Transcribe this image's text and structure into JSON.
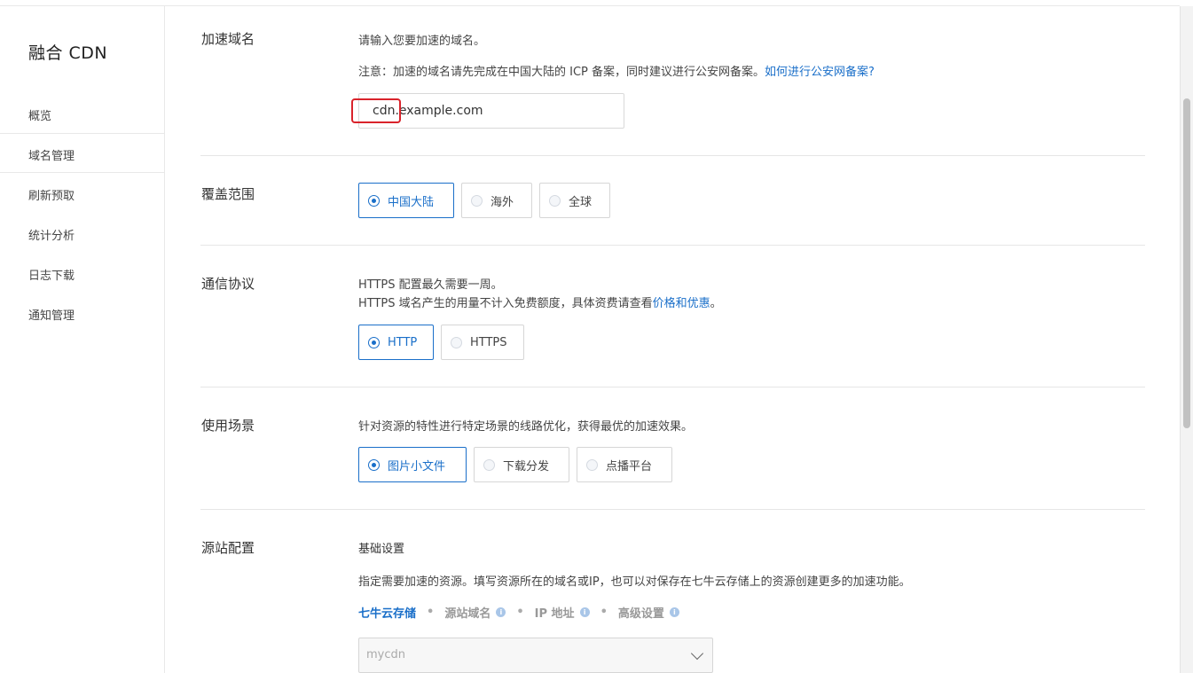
{
  "sidebar": {
    "brand": "融合 CDN",
    "items": [
      {
        "label": "概览"
      },
      {
        "label": "域名管理"
      },
      {
        "label": "刷新预取"
      },
      {
        "label": "统计分析"
      },
      {
        "label": "日志下载"
      },
      {
        "label": "通知管理"
      }
    ],
    "active_index": 1
  },
  "domain": {
    "title": "加速域名",
    "hint": "请输入您要加速的域名。",
    "note": "注意：加速的域名请先完成在中国大陆的 ICP 备案，同时建议进行公安网备案。",
    "note_link": "如何进行公安网备案?",
    "value": "cdn.example.com"
  },
  "coverage": {
    "title": "覆盖范围",
    "options": [
      "中国大陆",
      "海外",
      "全球"
    ],
    "selected": "中国大陆"
  },
  "protocol": {
    "title": "通信协议",
    "line1": "HTTPS 配置最久需要一周。",
    "line2": "HTTPS 域名产生的用量不计入免费额度，具体资费请查看",
    "line2_link": "价格和优惠",
    "line2_end": "。",
    "options": [
      "HTTP",
      "HTTPS"
    ],
    "selected": "HTTP"
  },
  "scenario": {
    "title": "使用场景",
    "desc": "针对资源的特性进行特定场景的线路优化，获得最优的加速效果。",
    "options": [
      "图片小文件",
      "下载分发",
      "点播平台"
    ],
    "selected": "图片小文件"
  },
  "origin": {
    "title": "源站配置",
    "subtitle": "基础设置",
    "desc": "指定需要加速的资源。填写资源所在的域名或IP，也可以对保存在七牛云存储上的资源创建更多的加速功能。",
    "tabs": [
      {
        "label": "七牛云存储",
        "info": false
      },
      {
        "label": "源站域名",
        "info": true
      },
      {
        "label": "IP 地址",
        "info": true
      },
      {
        "label": "高级设置",
        "info": true
      }
    ],
    "active_tab": "七牛云存储",
    "separator": "•",
    "info_glyph": "i",
    "bucket_value": "mycdn"
  },
  "colors": {
    "accent": "#1a6fc9",
    "highlight_box": "#d9232b"
  }
}
